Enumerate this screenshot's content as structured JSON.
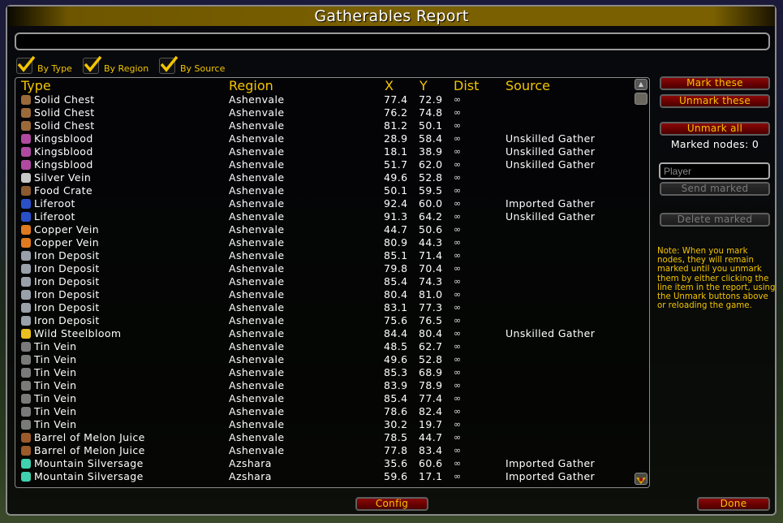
{
  "window": {
    "title": "Gatherables Report"
  },
  "search": {
    "value": "",
    "placeholder": ""
  },
  "filters": [
    {
      "label": "By Type",
      "checked": true
    },
    {
      "label": "By Region",
      "checked": true
    },
    {
      "label": "By Source",
      "checked": true
    }
  ],
  "table": {
    "headers": {
      "type": "Type",
      "region": "Region",
      "x": "X",
      "y": "Y",
      "dist": "Dist",
      "source": "Source"
    },
    "rows": [
      {
        "icon": "chest-icon",
        "type": "Solid Chest",
        "region": "Ashenvale",
        "x": "77.4",
        "y": "72.9",
        "dist": "∞",
        "source": ""
      },
      {
        "icon": "chest-icon",
        "type": "Solid Chest",
        "region": "Ashenvale",
        "x": "76.2",
        "y": "74.8",
        "dist": "∞",
        "source": ""
      },
      {
        "icon": "chest-icon",
        "type": "Solid Chest",
        "region": "Ashenvale",
        "x": "81.2",
        "y": "50.1",
        "dist": "∞",
        "source": ""
      },
      {
        "icon": "herb-icon",
        "type": "Kingsblood",
        "region": "Ashenvale",
        "x": "28.9",
        "y": "58.4",
        "dist": "∞",
        "source": "Unskilled Gather"
      },
      {
        "icon": "herb-icon",
        "type": "Kingsblood",
        "region": "Ashenvale",
        "x": "18.1",
        "y": "38.9",
        "dist": "∞",
        "source": "Unskilled Gather"
      },
      {
        "icon": "herb-icon",
        "type": "Kingsblood",
        "region": "Ashenvale",
        "x": "51.7",
        "y": "62.0",
        "dist": "∞",
        "source": "Unskilled Gather"
      },
      {
        "icon": "silver-ore-icon",
        "type": "Silver Vein",
        "region": "Ashenvale",
        "x": "49.6",
        "y": "52.8",
        "dist": "∞",
        "source": ""
      },
      {
        "icon": "crate-icon",
        "type": "Food Crate",
        "region": "Ashenvale",
        "x": "50.1",
        "y": "59.5",
        "dist": "∞",
        "source": ""
      },
      {
        "icon": "liferoot-icon",
        "type": "Liferoot",
        "region": "Ashenvale",
        "x": "92.4",
        "y": "60.0",
        "dist": "∞",
        "source": "Imported Gather"
      },
      {
        "icon": "liferoot-icon",
        "type": "Liferoot",
        "region": "Ashenvale",
        "x": "91.3",
        "y": "64.2",
        "dist": "∞",
        "source": "Unskilled Gather"
      },
      {
        "icon": "copper-ore-icon",
        "type": "Copper Vein",
        "region": "Ashenvale",
        "x": "44.7",
        "y": "50.6",
        "dist": "∞",
        "source": ""
      },
      {
        "icon": "copper-ore-icon",
        "type": "Copper Vein",
        "region": "Ashenvale",
        "x": "80.9",
        "y": "44.3",
        "dist": "∞",
        "source": ""
      },
      {
        "icon": "iron-ore-icon",
        "type": "Iron Deposit",
        "region": "Ashenvale",
        "x": "85.1",
        "y": "71.4",
        "dist": "∞",
        "source": ""
      },
      {
        "icon": "iron-ore-icon",
        "type": "Iron Deposit",
        "region": "Ashenvale",
        "x": "79.8",
        "y": "70.4",
        "dist": "∞",
        "source": ""
      },
      {
        "icon": "iron-ore-icon",
        "type": "Iron Deposit",
        "region": "Ashenvale",
        "x": "85.4",
        "y": "74.3",
        "dist": "∞",
        "source": ""
      },
      {
        "icon": "iron-ore-icon",
        "type": "Iron Deposit",
        "region": "Ashenvale",
        "x": "80.4",
        "y": "81.0",
        "dist": "∞",
        "source": ""
      },
      {
        "icon": "iron-ore-icon",
        "type": "Iron Deposit",
        "region": "Ashenvale",
        "x": "83.1",
        "y": "77.3",
        "dist": "∞",
        "source": ""
      },
      {
        "icon": "iron-ore-icon",
        "type": "Iron Deposit",
        "region": "Ashenvale",
        "x": "75.6",
        "y": "76.5",
        "dist": "∞",
        "source": ""
      },
      {
        "icon": "steelbloom-icon",
        "type": "Wild Steelbloom",
        "region": "Ashenvale",
        "x": "84.4",
        "y": "80.4",
        "dist": "∞",
        "source": "Unskilled Gather"
      },
      {
        "icon": "tin-ore-icon",
        "type": "Tin Vein",
        "region": "Ashenvale",
        "x": "48.5",
        "y": "62.7",
        "dist": "∞",
        "source": ""
      },
      {
        "icon": "tin-ore-icon",
        "type": "Tin Vein",
        "region": "Ashenvale",
        "x": "49.6",
        "y": "52.8",
        "dist": "∞",
        "source": ""
      },
      {
        "icon": "tin-ore-icon",
        "type": "Tin Vein",
        "region": "Ashenvale",
        "x": "85.3",
        "y": "68.9",
        "dist": "∞",
        "source": ""
      },
      {
        "icon": "tin-ore-icon",
        "type": "Tin Vein",
        "region": "Ashenvale",
        "x": "83.9",
        "y": "78.9",
        "dist": "∞",
        "source": ""
      },
      {
        "icon": "tin-ore-icon",
        "type": "Tin Vein",
        "region": "Ashenvale",
        "x": "85.4",
        "y": "77.4",
        "dist": "∞",
        "source": ""
      },
      {
        "icon": "tin-ore-icon",
        "type": "Tin Vein",
        "region": "Ashenvale",
        "x": "78.6",
        "y": "82.4",
        "dist": "∞",
        "source": ""
      },
      {
        "icon": "tin-ore-icon",
        "type": "Tin Vein",
        "region": "Ashenvale",
        "x": "30.2",
        "y": "19.7",
        "dist": "∞",
        "source": ""
      },
      {
        "icon": "barrel-icon",
        "type": "Barrel of Melon Juice",
        "region": "Ashenvale",
        "x": "78.5",
        "y": "44.7",
        "dist": "∞",
        "source": ""
      },
      {
        "icon": "barrel-icon",
        "type": "Barrel of Melon Juice",
        "region": "Ashenvale",
        "x": "77.8",
        "y": "83.4",
        "dist": "∞",
        "source": ""
      },
      {
        "icon": "silversage-icon",
        "type": "Mountain Silversage",
        "region": "Azshara",
        "x": "35.6",
        "y": "60.6",
        "dist": "∞",
        "source": "Imported Gather"
      },
      {
        "icon": "silversage-icon",
        "type": "Mountain Silversage",
        "region": "Azshara",
        "x": "59.6",
        "y": "17.1",
        "dist": "∞",
        "source": "Imported Gather"
      }
    ]
  },
  "icon_colors": {
    "chest-icon": "#9a6a3a",
    "herb-icon": "#b04aa0",
    "silver-ore-icon": "#c8c8c8",
    "crate-icon": "#8a5a30",
    "liferoot-icon": "#2a50c8",
    "copper-ore-icon": "#e07a20",
    "iron-ore-icon": "#9aa0aa",
    "steelbloom-icon": "#e8c020",
    "tin-ore-icon": "#7a7a7a",
    "barrel-icon": "#9a5a2a",
    "silversage-icon": "#40d0b0"
  },
  "side": {
    "mark_these": "Mark these",
    "unmark_these": "Unmark these",
    "unmark_all": "Unmark all",
    "marked_nodes": "Marked nodes: 0",
    "player_placeholder": "Player",
    "send_marked": "Send marked",
    "delete_marked": "Delete marked",
    "note": "Note: When you mark nodes, they will remain marked until you unmark them by either clicking the line item in the report, using the Unmark buttons above or reloading the game."
  },
  "footer": {
    "config": "Config",
    "done": "Done"
  },
  "colors": {
    "accent_gold": "#f3c500",
    "button_red": "#6a0000",
    "title_bar": "#7a6000"
  }
}
